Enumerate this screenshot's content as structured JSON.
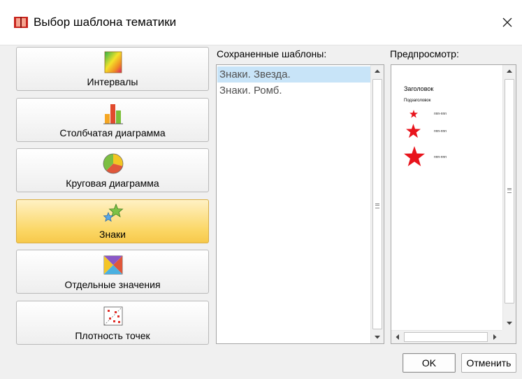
{
  "window": {
    "title": "Выбор шаблона тематики",
    "icon": "map-book-icon",
    "close_icon": "close-icon"
  },
  "templates": [
    {
      "label": "Интервалы",
      "icon": "gradient-ramp-icon",
      "selected": false
    },
    {
      "label": "Столбчатая диаграмма",
      "icon": "bar-chart-icon",
      "selected": false
    },
    {
      "label": "Круговая диаграмма",
      "icon": "pie-chart-icon",
      "selected": false
    },
    {
      "label": "Знаки",
      "icon": "stars-icon",
      "selected": true
    },
    {
      "label": "Отдельные значения",
      "icon": "unique-values-icon",
      "selected": false
    },
    {
      "label": "Плотность точек",
      "icon": "dot-density-icon",
      "selected": false
    }
  ],
  "saved": {
    "label": "Сохраненные шаблоны:",
    "items": [
      {
        "label": "Знаки. Звезда.",
        "selected": true
      },
      {
        "label": "Знаки. Ромб.",
        "selected": false
      }
    ]
  },
  "preview": {
    "label": "Предпросмотр:",
    "title": "Заголовок",
    "subtitle": "Подзаголовок",
    "item_labels": [
      "ппп-ппп",
      "ппп-ппп",
      "ппп-ппп"
    ],
    "symbol_color": "#e8141c"
  },
  "buttons": {
    "ok": "OK",
    "cancel": "Отменить"
  },
  "colors": {
    "selected_template": "#fbd766",
    "selected_list_item": "#c8e4f8"
  }
}
